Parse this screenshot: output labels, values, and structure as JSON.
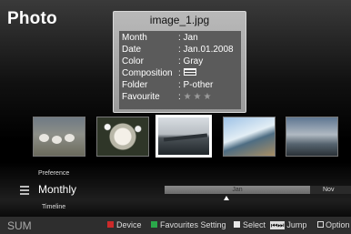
{
  "app": {
    "title": "Photo"
  },
  "info": {
    "filename": "image_1.jpg",
    "rows": [
      {
        "key": "Month",
        "value": ": Jan"
      },
      {
        "key": "Date",
        "value": ": Jan.01.2008"
      },
      {
        "key": "Color",
        "value": ": Gray"
      },
      {
        "key": "Composition",
        "value": ":",
        "icon": "composition-lines-icon"
      },
      {
        "key": "Folder",
        "value": ": P-other"
      },
      {
        "key": "Favourite",
        "value": ":",
        "stars": "★★★"
      }
    ]
  },
  "thumbnails": [
    {
      "name": "sheep-photo",
      "selected": false
    },
    {
      "name": "daisy-photo",
      "selected": false
    },
    {
      "name": "lake-photo",
      "selected": true
    },
    {
      "name": "beach-photo",
      "selected": false
    },
    {
      "name": "waves-photo",
      "selected": false
    }
  ],
  "sort": {
    "preference_label": "Preference",
    "current": "Monthly",
    "timeline_label": "Timeline",
    "icon": "list-icon"
  },
  "timeline": {
    "current_label": "Jan",
    "next_label": "Nov"
  },
  "bottom_bar": {
    "source": "SUM",
    "device": "Device",
    "favourites": "Favourites Setting",
    "select": "Select",
    "jump": "Jump",
    "jump_icon": "⏮⏭",
    "option": "Option"
  },
  "colors": {
    "red_key": "#cc2a2a",
    "green_key": "#2aa84a",
    "white_key": "#e8e8e8"
  }
}
